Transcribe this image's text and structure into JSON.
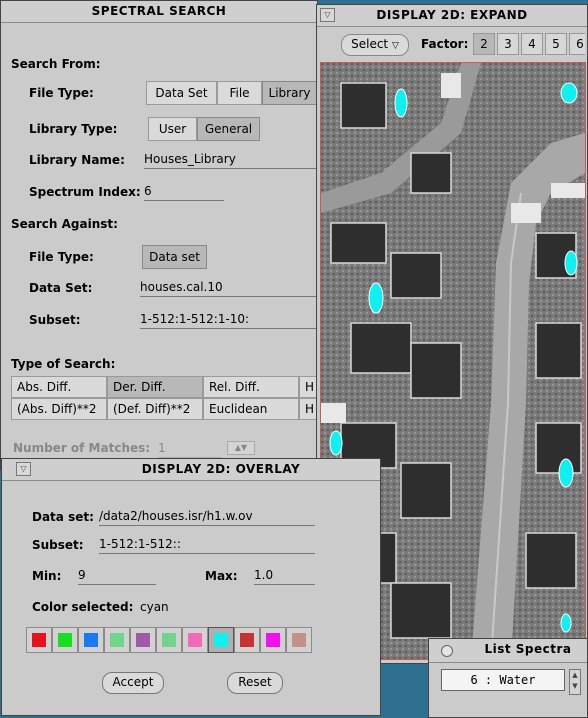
{
  "spectral_search": {
    "title": "SPECTRAL SEARCH",
    "search_from": {
      "heading": "Search From:",
      "file_type_label": "File Type:",
      "file_type_options": [
        "Data Set",
        "File",
        "Library"
      ],
      "library_type_label": "Library Type:",
      "library_type_options": [
        "User",
        "General"
      ],
      "library_name_label": "Library Name:",
      "library_name_value": "Houses_Library",
      "spectrum_index_label": "Spectrum Index:",
      "spectrum_index_value": "6"
    },
    "search_against": {
      "heading": "Search Against:",
      "file_type_label": "File Type:",
      "file_type_value": "Data set",
      "data_set_label": "Data Set:",
      "data_set_value": "houses.cal.10",
      "subset_label": "Subset:",
      "subset_value": "1-512:1-512:1-10:"
    },
    "type_of_search": {
      "heading": "Type of Search:",
      "options": [
        "Abs. Diff.",
        "Der. Diff.",
        "Rel. Diff.",
        "H",
        "(Abs. Diff)**2",
        "(Def. Diff)**2",
        "Euclidean",
        "H"
      ]
    },
    "matches_label": "Number of Matches:",
    "matches_value": "1"
  },
  "display_expand": {
    "title": "DISPLAY 2D: EXPAND",
    "select_label": "Select",
    "factor_label": "Factor:",
    "factors": [
      "2",
      "3",
      "4",
      "5",
      "6"
    ]
  },
  "display_overlay": {
    "title": "DISPLAY 2D: OVERLAY",
    "data_set_label": "Data set:",
    "data_set_value": "/data2/houses.isr/h1.w.ov",
    "subset_label": "Subset:",
    "subset_value": "1-512:1-512::",
    "min_label": "Min:",
    "min_value": "9",
    "max_label": "Max:",
    "max_value": "1.0",
    "color_label": "Color selected:",
    "color_value": "cyan",
    "colors": [
      "#e8121c",
      "#18e020",
      "#1a78f0",
      "#6ed68a",
      "#a05aa8",
      "#72d48c",
      "#f06ab8",
      "#10f0f0",
      "#c83232",
      "#f010f0",
      "#c49088"
    ],
    "selected_color": "#10f0f0",
    "accept_label": "Accept",
    "reset_label": "Reset"
  },
  "list_spectra": {
    "title": "List Spectra",
    "items": [
      "6 : Water"
    ]
  }
}
